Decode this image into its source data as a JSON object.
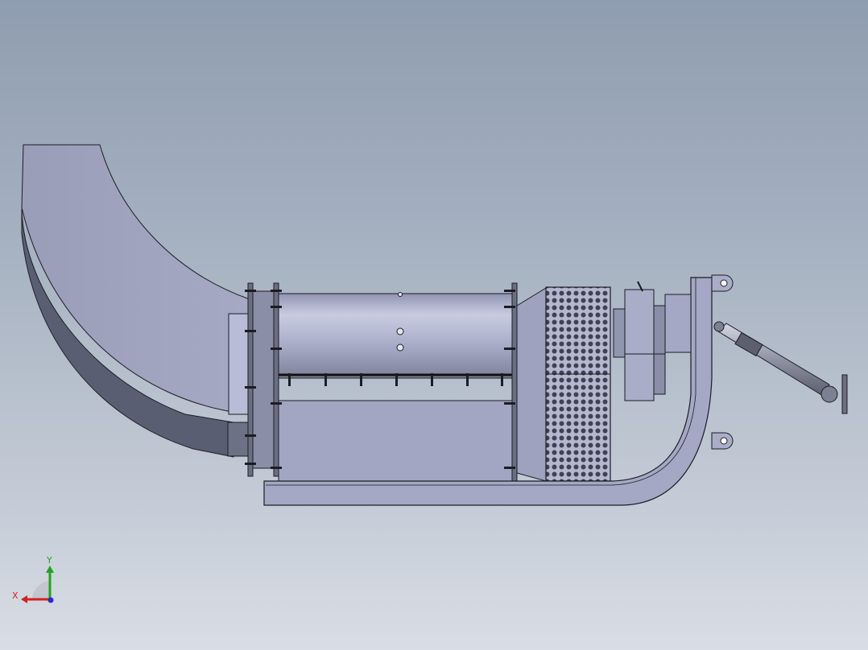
{
  "viewport": {
    "background_top": "#8f9db0",
    "background_bottom": "#d9dde5"
  },
  "model": {
    "body_color": "#a7abc7",
    "dark_color": "#565a6c",
    "outline_color": "#1c1c24"
  },
  "triad": {
    "x_label": "X",
    "y_label": "Y",
    "x_color": "#d42020",
    "y_color": "#1aa81a",
    "z_color": "#2030d0"
  }
}
